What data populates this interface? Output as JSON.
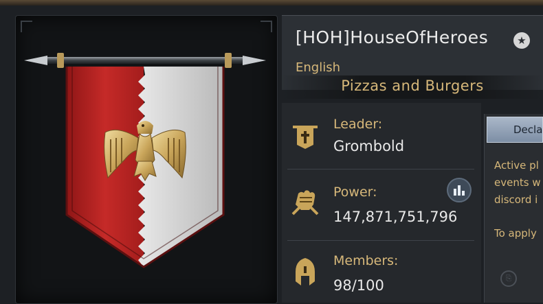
{
  "guild": {
    "name": "[HOH]HouseOfHeroes",
    "language": "English",
    "motto": "Pizzas and Burgers"
  },
  "stats": {
    "leader_label": "Leader:",
    "leader_value": "Grombold",
    "power_label": "Power:",
    "power_value": "147,871,751,796",
    "members_label": "Members:",
    "members_value": "98/100"
  },
  "right_panel": {
    "button_label": "Decla",
    "desc_lines": [
      "Active pl",
      "events w",
      "discord i"
    ],
    "apply_text": "To apply"
  },
  "icons": {
    "star": "star-icon",
    "leader": "banner-cross-icon",
    "power": "fist-icon",
    "members": "helmet-icon",
    "stats": "bar-chart-icon",
    "emblem": "eagle-emblem"
  },
  "colors": {
    "banner_red": "#b5201f",
    "banner_white": "#d9d9d9",
    "gold": "#d7b87a",
    "background": "#1d2024"
  }
}
